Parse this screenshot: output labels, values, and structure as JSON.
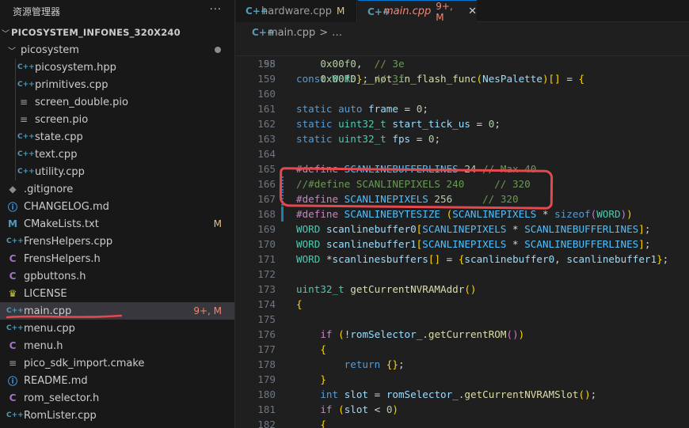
{
  "sidebar": {
    "title": "资源管理器",
    "more": "···",
    "root": "PICOSYSTEM_INFONES_320X240",
    "folder": "picosystem",
    "items": [
      {
        "label": "picosystem.hpp",
        "icon": "C++",
        "type": "cpp",
        "badge": ""
      },
      {
        "label": "primitives.cpp",
        "icon": "C++",
        "type": "cpp",
        "badge": ""
      },
      {
        "label": "screen_double.pio",
        "icon": "≡",
        "type": "lines",
        "badge": ""
      },
      {
        "label": "screen.pio",
        "icon": "≡",
        "type": "lines",
        "badge": ""
      },
      {
        "label": "state.cpp",
        "icon": "C++",
        "type": "cpp",
        "badge": ""
      },
      {
        "label": "text.cpp",
        "icon": "C++",
        "type": "cpp",
        "badge": ""
      },
      {
        "label": "utility.cpp",
        "icon": "C++",
        "type": "cpp",
        "badge": ""
      },
      {
        "label": ".gitignore",
        "icon": "◆",
        "type": "git",
        "badge": ""
      },
      {
        "label": "CHANGELOG.md",
        "icon": "ⓘ",
        "type": "info",
        "badge": ""
      },
      {
        "label": "CMakeLists.txt",
        "icon": "M",
        "type": "cmake",
        "badge": "M"
      },
      {
        "label": "FrensHelpers.cpp",
        "icon": "C++",
        "type": "cpp",
        "badge": ""
      },
      {
        "label": "FrensHelpers.h",
        "icon": "C",
        "type": "h",
        "badge": ""
      },
      {
        "label": "gpbuttons.h",
        "icon": "C",
        "type": "h",
        "badge": ""
      },
      {
        "label": "LICENSE",
        "icon": "♛",
        "type": "lic",
        "badge": ""
      },
      {
        "label": "main.cpp",
        "icon": "C++",
        "type": "cpp",
        "badge": "9+, M",
        "active": true
      },
      {
        "label": "menu.cpp",
        "icon": "C++",
        "type": "cpp",
        "badge": ""
      },
      {
        "label": "menu.h",
        "icon": "C",
        "type": "h",
        "badge": ""
      },
      {
        "label": "pico_sdk_import.cmake",
        "icon": "≡",
        "type": "lines",
        "badge": ""
      },
      {
        "label": "README.md",
        "icon": "ⓘ",
        "type": "info",
        "badge": ""
      },
      {
        "label": "rom_selector.h",
        "icon": "C",
        "type": "h",
        "badge": ""
      },
      {
        "label": "RomLister.cpp",
        "icon": "C++",
        "type": "cpp",
        "badge": ""
      }
    ]
  },
  "tabs": [
    {
      "label": "hardware.cpp",
      "badge": "M",
      "icon": "C++"
    },
    {
      "label": "main.cpp",
      "badge": "9+, M",
      "icon": "C++",
      "close": "✕"
    }
  ],
  "breadcrumb": {
    "file": "main.cpp",
    "sep": ">",
    "rest": "…",
    "icon": "C++"
  },
  "colors": {
    "accent": "#0078d4",
    "annotation": "#e5484d",
    "error": "#f48771",
    "modified": "#e2c08d"
  },
  "editor": {
    "sticky": {
      "num": "95",
      "text": "const WORD __not_in_flash_func(NesPalette)[] = {"
    },
    "lines": [
      {
        "num": "158",
        "text": "    0x00f0,  // 3e"
      },
      {
        "num": "159",
        "text": "    0x00f0}; // 3f"
      },
      {
        "num": "160",
        "text": ""
      },
      {
        "num": "161",
        "text": "static auto frame = 0;"
      },
      {
        "num": "162",
        "text": "static uint32_t start_tick_us = 0;"
      },
      {
        "num": "163",
        "text": "static uint32_t fps = 0;"
      },
      {
        "num": "164",
        "text": ""
      },
      {
        "num": "165",
        "text": "#define SCANLINEBUFFERLINES 24 // Max 40"
      },
      {
        "num": "166",
        "text": "//#define SCANLINEPIXELS 240     // 320"
      },
      {
        "num": "167",
        "text": "#define SCANLINEPIXELS 256     // 320"
      },
      {
        "num": "168",
        "text": "#define SCANLINEBYTESIZE (SCANLINEPIXELS * sizeof(WORD))"
      },
      {
        "num": "169",
        "text": "WORD scanlinebuffer0[SCANLINEPIXELS * SCANLINEBUFFERLINES];"
      },
      {
        "num": "170",
        "text": "WORD scanlinebuffer1[SCANLINEPIXELS * SCANLINEBUFFERLINES];"
      },
      {
        "num": "171",
        "text": "WORD *scanlinesbuffers[] = {scanlinebuffer0, scanlinebuffer1};"
      },
      {
        "num": "172",
        "text": ""
      },
      {
        "num": "173",
        "text": "uint32_t getCurrentNVRAMAddr()"
      },
      {
        "num": "174",
        "text": "{"
      },
      {
        "num": "175",
        "text": ""
      },
      {
        "num": "176",
        "text": "    if (!romSelector_.getCurrentROM())"
      },
      {
        "num": "177",
        "text": "    {"
      },
      {
        "num": "178",
        "text": "        return {};"
      },
      {
        "num": "179",
        "text": "    }"
      },
      {
        "num": "180",
        "text": "    int slot = romSelector_.getCurrentNVRAMSlot();"
      },
      {
        "num": "181",
        "text": "    if (slot < 0)"
      },
      {
        "num": "182",
        "text": "    {"
      }
    ]
  }
}
